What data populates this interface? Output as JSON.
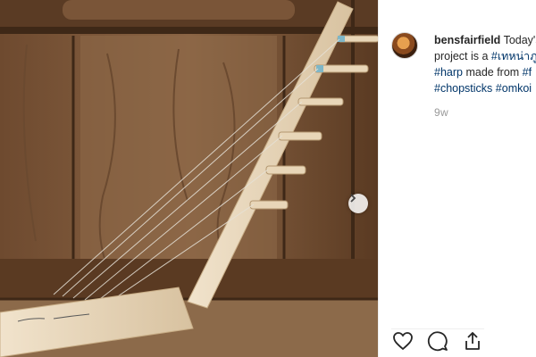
{
  "post": {
    "username": "bensfairfield",
    "caption_lines": [
      {
        "text": " Today's",
        "hashtag": ""
      },
      {
        "text": "project is a ",
        "hashtag": "#เทหน่าภู"
      },
      {
        "hashtag": "#harp",
        "text": " made from ",
        "hashtag2": "#f"
      },
      {
        "hashtag": "#chopsticks",
        "hashtag2": " #omkoi"
      }
    ],
    "time_ago": "9w"
  },
  "colors": {
    "hashtag": "#003569",
    "text": "#262626",
    "muted": "#999999"
  },
  "icons": {
    "next": "chevron-right-icon",
    "like": "heart-icon",
    "comment": "comment-icon",
    "share": "share-icon"
  }
}
